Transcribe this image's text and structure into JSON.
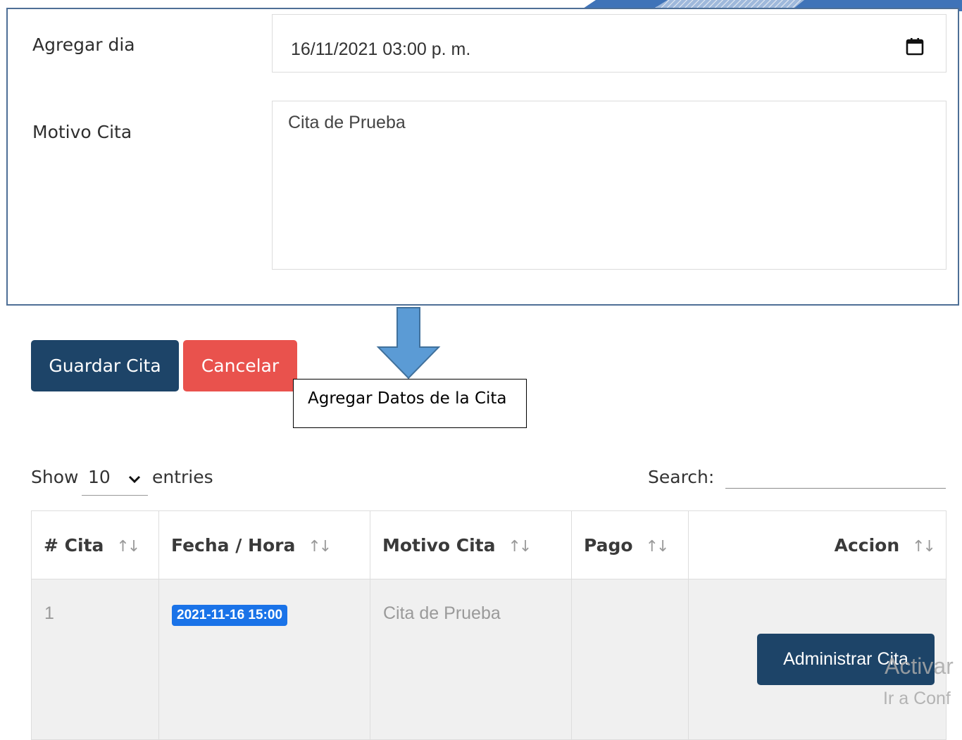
{
  "form": {
    "date_label": "Agregar dia",
    "date_value": "16/11/2021 03:00 p. m.",
    "reason_label": "Motivo Cita",
    "reason_value": "Cita de Prueba"
  },
  "buttons": {
    "save_label": "Guardar Cita",
    "cancel_label": "Cancelar"
  },
  "annotation": {
    "callout_text": "Agregar Datos de la Cita"
  },
  "table_controls": {
    "show_label": "Show",
    "entries_selected": "10",
    "entries_label": "entries",
    "search_label": "Search:"
  },
  "table": {
    "columns": [
      "# Cita",
      "Fecha / Hora",
      "Motivo Cita",
      "Pago",
      "Accion"
    ],
    "sort_icon": "↑↓",
    "rows": [
      {
        "id": "1",
        "datetime": "2021-11-16 15:00",
        "reason": "Cita de Prueba",
        "payment": "",
        "action_label": "Administrar Cita"
      }
    ]
  },
  "watermark": {
    "line1": "Activar",
    "line2": "Ir a Conf"
  },
  "colors": {
    "primary": "#1d4468",
    "danger": "#e9524d",
    "badge": "#1a73e8",
    "arrow": "#5b9bd5",
    "frame": "#4e6f96"
  },
  "icons": {
    "date_field": "calendar-icon",
    "select": "chevron-down-icon",
    "sort": "sort-icon",
    "annotation": "arrow-down-icon"
  }
}
